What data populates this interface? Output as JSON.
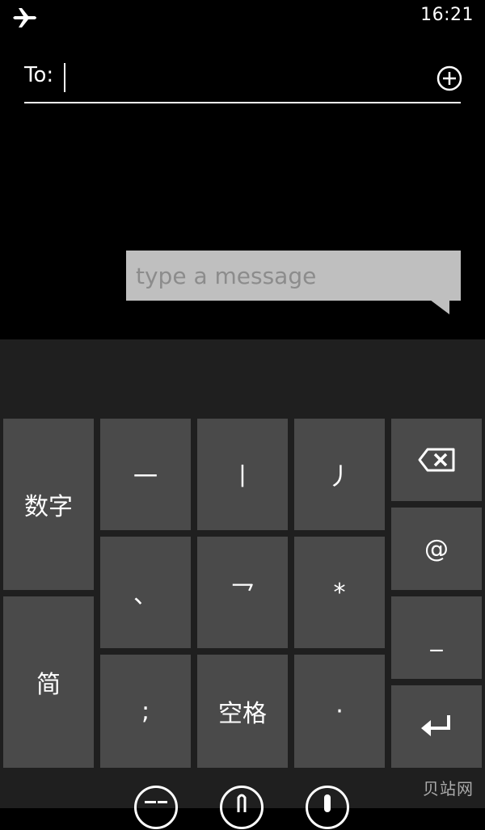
{
  "status_bar": {
    "time": "16:21"
  },
  "compose": {
    "to_label": "To:",
    "to_value": "",
    "message_placeholder": "type a message"
  },
  "keyboard": {
    "keys": {
      "numbers": "数字",
      "simplified": "简",
      "stroke_heng": "一",
      "stroke_shu": "丨",
      "stroke_pie": "丿",
      "stroke_dian": "、",
      "stroke_zhe": "乛",
      "star": "*",
      "at": "@",
      "semicolon": ";",
      "space": "空格",
      "dot": "·",
      "underscore": "_"
    }
  },
  "watermark": "贝站网",
  "colors": {
    "background": "#000000",
    "keyboard_bg": "#1f1f1f",
    "key_bg": "#4a4a4a",
    "bubble_bg": "#bfbfbf"
  },
  "icons": {
    "airplane": "airplane-icon",
    "add_recipient": "plus-circle-icon",
    "backspace": "backspace-icon",
    "enter": "enter-icon",
    "emoji": "emoji-icon",
    "attach": "attach-icon",
    "mic": "mic-icon"
  }
}
